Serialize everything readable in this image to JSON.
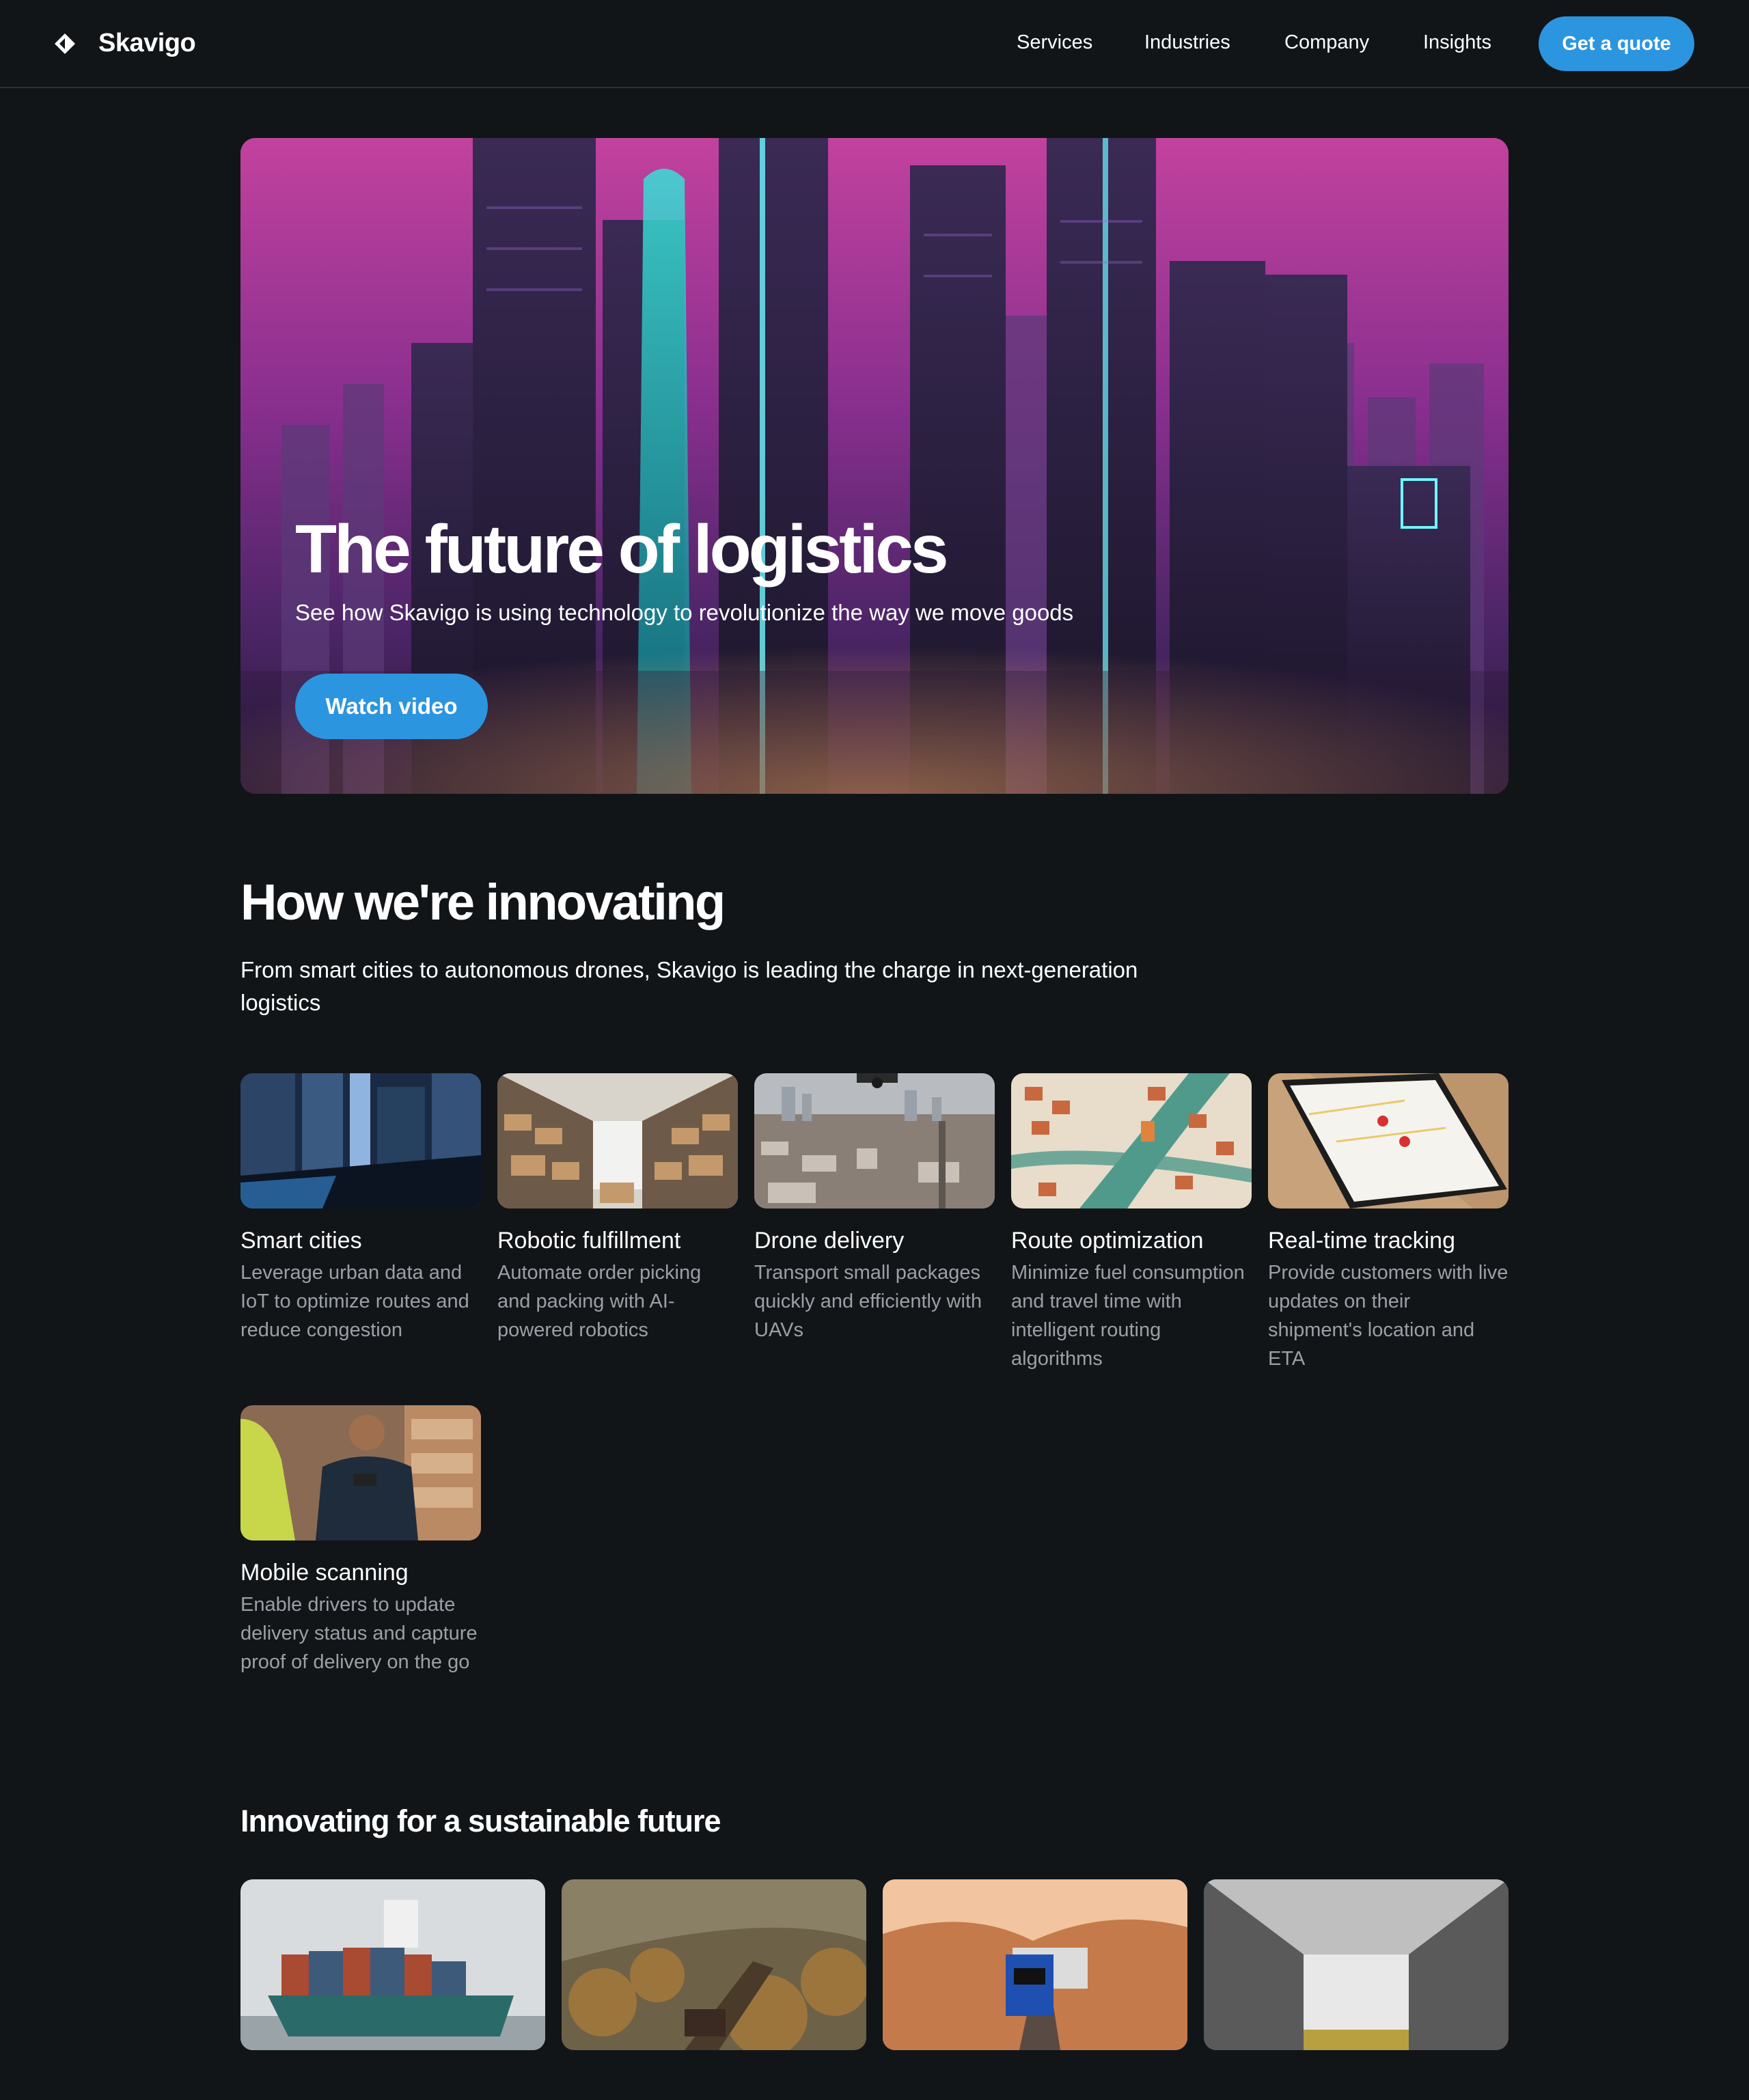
{
  "brand": {
    "name": "Skavigo"
  },
  "nav": {
    "links": [
      "Services",
      "Industries",
      "Company",
      "Insights"
    ],
    "cta": "Get a quote"
  },
  "hero": {
    "title": "The future of logistics",
    "subtitle": "See how Skavigo is using technology to revolutionize the way we move goods",
    "button": "Watch video"
  },
  "innovating": {
    "title": "How we're innovating",
    "description": "From smart cities to autonomous drones, Skavigo is leading the charge in next-generation logistics",
    "cards": [
      {
        "title": "Smart cities",
        "description": "Leverage urban data and IoT to optimize routes and reduce congestion"
      },
      {
        "title": "Robotic fulfillment",
        "description": "Automate order picking and packing with AI-powered robotics"
      },
      {
        "title": "Drone delivery",
        "description": "Transport small packages quickly and efficiently with UAVs"
      },
      {
        "title": "Route optimization",
        "description": "Minimize fuel consumption and travel time with intelligent routing algorithms"
      },
      {
        "title": "Real-time tracking",
        "description": "Provide customers with live updates on their shipment's location and ETA"
      },
      {
        "title": "Mobile scanning",
        "description": "Enable drivers to update delivery status and capture proof of delivery on the go"
      }
    ]
  },
  "sustainable": {
    "title": "Innovating for a sustainable future"
  },
  "colors": {
    "background": "#111518",
    "accent": "#2c95e0",
    "muted_text": "#9aa0a6"
  }
}
